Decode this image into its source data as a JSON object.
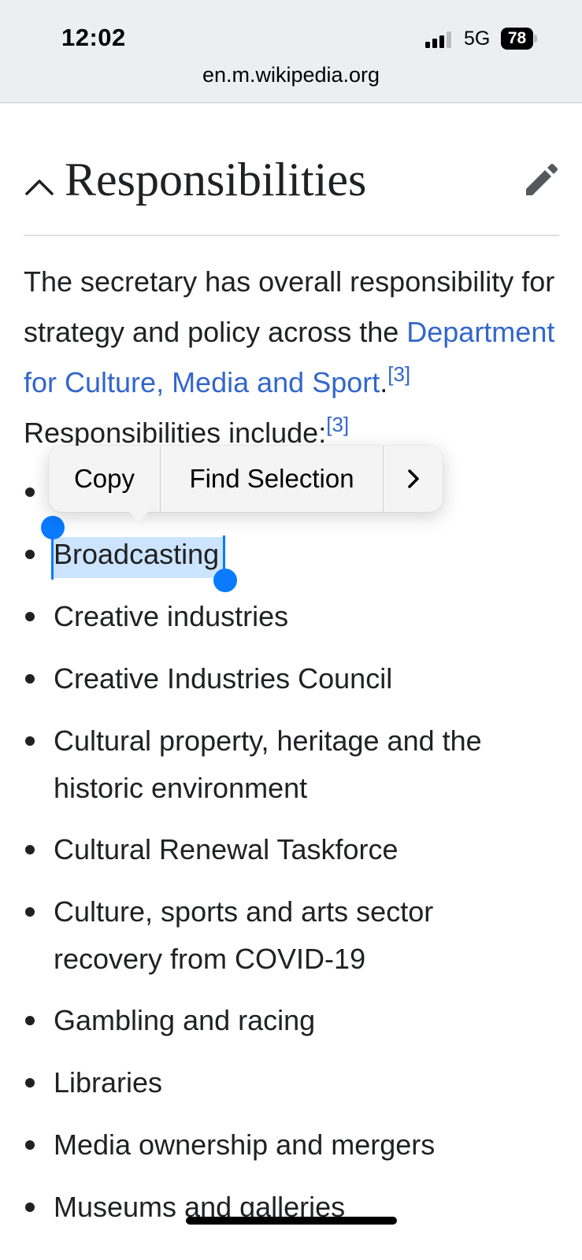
{
  "status_bar": {
    "time": "12:02",
    "network": "5G",
    "battery": "78",
    "signal_bars_active": 3,
    "signal_bars_total": 4
  },
  "browser": {
    "url": "en.m.wikipedia.org"
  },
  "section": {
    "heading": "Responsibilities",
    "collapse_icon": "chevron-up-icon",
    "edit_icon": "pencil-icon"
  },
  "paragraph": {
    "text_1": "The secretary has overall responsibility for strategy and policy across the ",
    "link_text": "Department for Culture, Media and Sport",
    "text_2": ".",
    "ref_1": "[3]",
    "text_3": " Responsibilities include:",
    "ref_2": "[3]"
  },
  "list_items": [
    "",
    "Broadcasting",
    "Creative industries",
    "Creative Industries Council",
    "Cultural property, heritage and the",
    "historic environment",
    "Cultural Renewal Taskforce",
    "Culture, sports and arts sector",
    "recovery from COVID-19",
    "Gambling and racing",
    "Libraries",
    "Media ownership and mergers",
    "Museums and galleries"
  ],
  "selection": {
    "selected_text": "Broadcasting",
    "highlight_color": "#cfe2fc",
    "handle_color": "#0a7aff"
  },
  "context_menu": {
    "copy_label": "Copy",
    "find_label": "Find Selection",
    "more_label": "›"
  },
  "colors": {
    "link": "#3366cc",
    "text": "#202122",
    "topbar": "#eceef1"
  }
}
